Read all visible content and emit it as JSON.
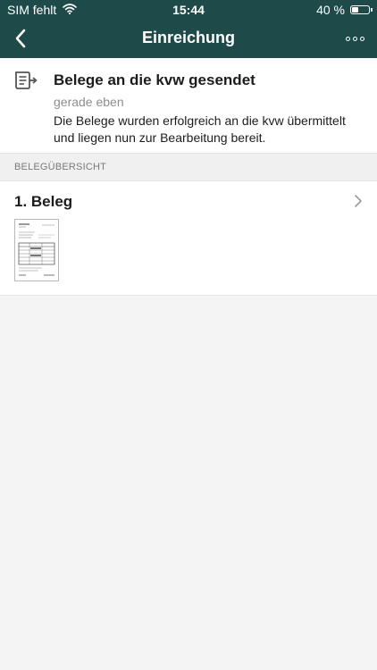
{
  "status_bar": {
    "carrier": "SIM fehlt",
    "time": "15:44",
    "battery_text": "40 %",
    "battery_level": 0.4,
    "wifi_icon": "wifi-icon"
  },
  "nav": {
    "title": "Einreichung",
    "back_icon": "chevron-left-icon",
    "more_icon": "more-icon"
  },
  "message": {
    "icon": "document-send-icon",
    "title": "Belege an die kvw gesendet",
    "time": "gerade eben",
    "body": "Die Belege wurden erfolgreich an die kvw übermittelt und liegen nun zur Bearbeitung bereit."
  },
  "section": {
    "label": "BELEGÜBERSICHT"
  },
  "belege": [
    {
      "title": "1. Beleg",
      "thumbnail": "document-thumbnail"
    }
  ],
  "colors": {
    "header_bg": "#1f4a4a",
    "page_bg": "#f4f4f4",
    "card_bg": "#ffffff",
    "muted_text": "#8e8e8e"
  }
}
